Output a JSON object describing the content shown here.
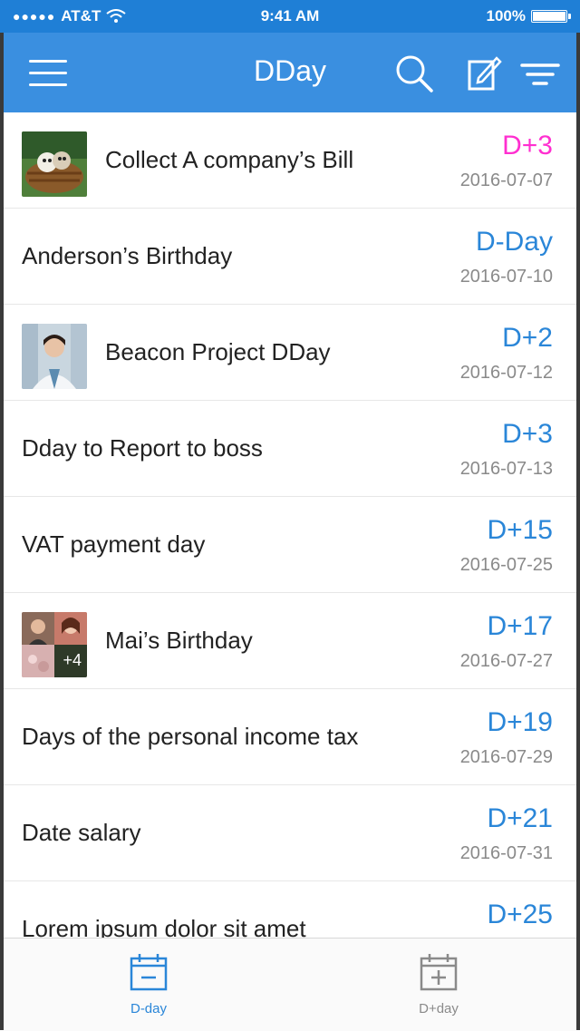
{
  "status_bar": {
    "carrier": "AT&T",
    "time": "9:41 AM",
    "battery": "100%",
    "battery_level": 1.0
  },
  "header": {
    "title": "DDay"
  },
  "colors": {
    "nav": "#3a8fe0",
    "status": "#1f7fd6",
    "accent": "#2a86d8",
    "highlight": "#ff2fd0"
  },
  "items": [
    {
      "title": "Collect A company’s Bill",
      "badge": "D+3",
      "date": "2016-07-07",
      "thumb": "pets-basket-image",
      "highlight": true
    },
    {
      "title": "Anderson’s Birthday",
      "badge": "D-Day",
      "date": "2016-07-10"
    },
    {
      "title": "Beacon Project DDay",
      "badge": "D+2",
      "date": "2016-07-12",
      "thumb": "doctor-portrait-image"
    },
    {
      "title": "Dday to Report to boss",
      "badge": "D+3",
      "date": "2016-07-13"
    },
    {
      "title": "VAT payment day",
      "badge": "D+15",
      "date": "2016-07-25"
    },
    {
      "title": "Mai’s Birthday",
      "badge": "D+17",
      "date": "2016-07-27",
      "thumb": "photo-collage-image",
      "thumb_count": "+4"
    },
    {
      "title": "Days of the personal income tax",
      "badge": "D+19",
      "date": "2016-07-29"
    },
    {
      "title": "Date salary",
      "badge": "D+21",
      "date": "2016-07-31"
    },
    {
      "title": "Lorem ipsum dolor sit amet",
      "badge": "D+25",
      "date": ""
    }
  ],
  "tabs": [
    {
      "label": "D-day",
      "icon": "calendar-minus-icon",
      "active": true
    },
    {
      "label": "D+day",
      "icon": "calendar-plus-icon",
      "active": false
    }
  ]
}
